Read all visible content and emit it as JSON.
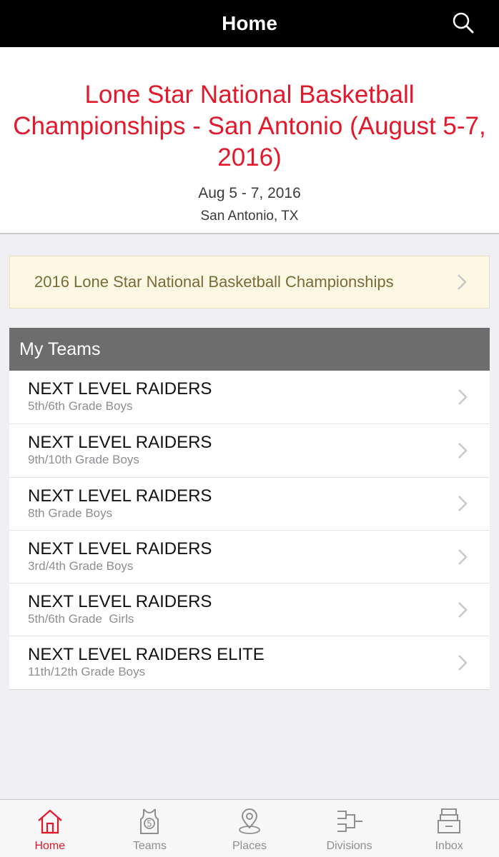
{
  "navbar": {
    "title": "Home",
    "search_icon": "search-icon"
  },
  "event": {
    "title": "Lone Star National Basketball Championships - San Antonio (August 5-7, 2016)",
    "dates": "Aug 5 - 7, 2016",
    "location": "San Antonio, TX"
  },
  "banner": {
    "label": "2016 Lone Star National Basketball Championships"
  },
  "my_teams": {
    "header": "My Teams",
    "teams": [
      {
        "name": "NEXT LEVEL RAIDERS",
        "division": "5th/6th Grade Boys"
      },
      {
        "name": "NEXT LEVEL RAIDERS",
        "division": "9th/10th Grade Boys"
      },
      {
        "name": "NEXT LEVEL RAIDERS",
        "division": "8th Grade Boys"
      },
      {
        "name": "NEXT LEVEL RAIDERS",
        "division": "3rd/4th Grade Boys"
      },
      {
        "name": "NEXT LEVEL RAIDERS",
        "division": "5th/6th Grade  Girls"
      },
      {
        "name": "NEXT LEVEL RAIDERS ELITE",
        "division": "11th/12th Grade Boys"
      }
    ]
  },
  "tabbar": {
    "tabs": [
      {
        "label": "Home",
        "icon": "home-icon",
        "active": true
      },
      {
        "label": "Teams",
        "icon": "jersey-icon",
        "active": false
      },
      {
        "label": "Places",
        "icon": "map-pin-icon",
        "active": false
      },
      {
        "label": "Divisions",
        "icon": "bracket-icon",
        "active": false
      },
      {
        "label": "Inbox",
        "icon": "inbox-icon",
        "active": false
      }
    ]
  },
  "colors": {
    "accent": "#e2182b",
    "navbar": "#000000",
    "banner_bg": "#fcf8e3",
    "section_header": "#6d6d6d"
  }
}
